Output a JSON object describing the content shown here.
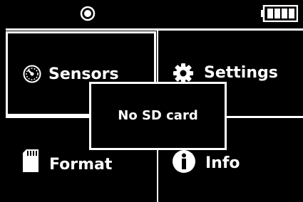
{
  "status_bar": {
    "left_indicator_icon": "record-dot-icon",
    "battery_icon": "battery-full-icon",
    "battery_bars": 4
  },
  "menu": {
    "items": [
      {
        "id": "sensors",
        "label": "Sensors",
        "icon": "sensors-dial-icon",
        "selected": true
      },
      {
        "id": "settings",
        "label": "Settings",
        "icon": "gear-icon",
        "selected": false
      },
      {
        "id": "format",
        "label": "Format",
        "icon": "sd-card-icon",
        "selected": false
      },
      {
        "id": "info",
        "label": "Info",
        "icon": "info-icon",
        "selected": false
      }
    ]
  },
  "dialog": {
    "message": "No SD card"
  },
  "colors": {
    "background": "#000000",
    "foreground": "#ffffff"
  }
}
